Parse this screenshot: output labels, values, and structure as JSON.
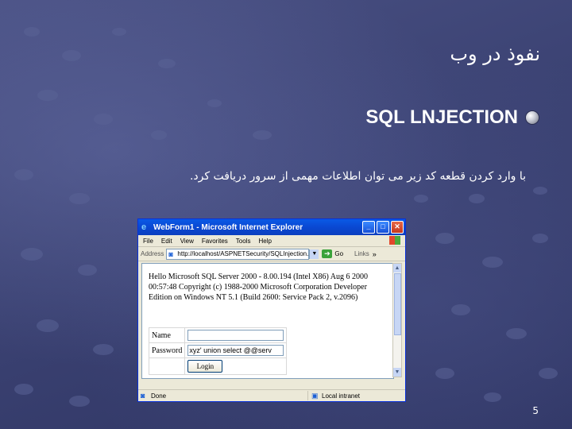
{
  "slide": {
    "title": "نفوذ در وب",
    "bullet": "SQL LNJECTION",
    "subtext": "با وارد کردن قطعه کد زیر می توان اطلاعات مهمی از سرور دریافت کرد.",
    "page_number": "5"
  },
  "window": {
    "title": "WebForm1 - Microsoft Internet Explorer",
    "menu": [
      "File",
      "Edit",
      "View",
      "Favorites",
      "Tools",
      "Help"
    ],
    "address_label": "Address",
    "address_value": "http://localhost/ASPNETSecurity/SQLInjection.",
    "go_label": "Go",
    "links_label": "Links",
    "content": {
      "message": "Hello Microsoft SQL Server 2000 - 8.00.194 (Intel X86) Aug 6 2000 00:57:48 Copyright (c) 1988-2000 Microsoft Corporation Developer Edition on Windows NT 5.1 (Build 2600: Service Pack 2, v.2096)",
      "name_label": "Name",
      "name_value": "",
      "password_label": "Password",
      "password_value": "xyz' union select @@serv",
      "login_label": "Login"
    },
    "status_text": "Done",
    "zone_text": "Local intranet"
  }
}
